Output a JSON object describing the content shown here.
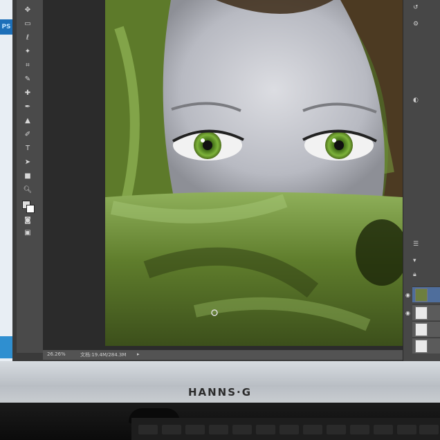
{
  "app": {
    "badge": "PS",
    "status_zoom": "26.26%",
    "status_doc": "文档:19.4M/284.3M"
  },
  "toolbar": {
    "tools": [
      "move-tool",
      "marquee-tool",
      "lasso-tool",
      "magic-wand-tool",
      "crop-tool",
      "eyedropper-tool",
      "healing-tool",
      "brush-tool",
      "stamp-tool",
      "history-brush-tool",
      "eraser-tool",
      "gradient-tool",
      "blur-tool",
      "dodge-tool",
      "pen-tool",
      "type-tool",
      "path-select-tool",
      "shape-tool",
      "hand-tool",
      "zoom-tool",
      "color-swatches",
      "quick-mask",
      "screen-mode"
    ]
  },
  "layers": {
    "count": 5
  },
  "monitor": {
    "brand": "HANNS·G"
  },
  "colors": {
    "accent": "#1d6fb8",
    "canvas_green": "#6d7f3f"
  }
}
